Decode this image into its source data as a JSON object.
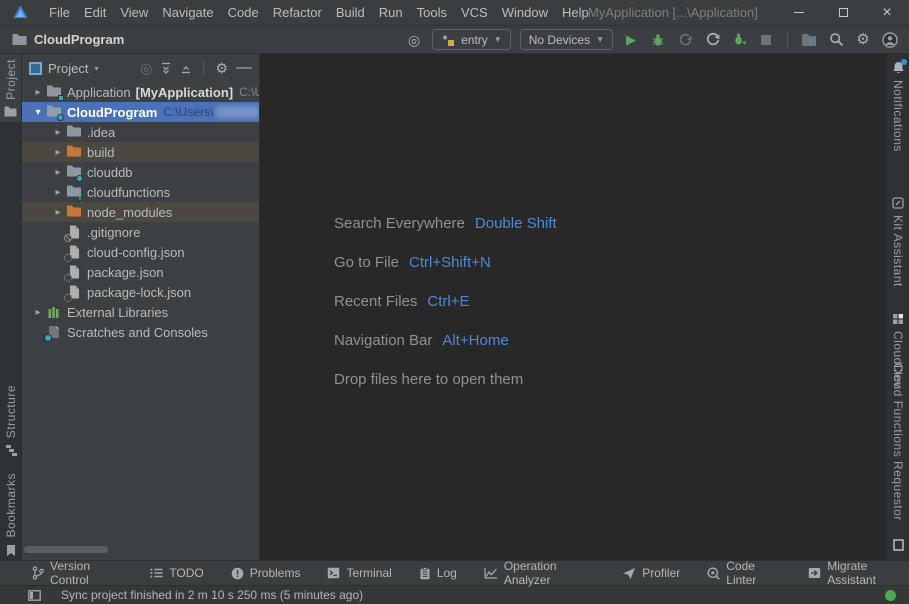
{
  "window": {
    "title": "MyApplication [...\\Application]"
  },
  "menu": {
    "items": [
      "File",
      "Edit",
      "View",
      "Navigate",
      "Code",
      "Refactor",
      "Build",
      "Run",
      "Tools",
      "VCS",
      "Window",
      "Help"
    ]
  },
  "toolbar": {
    "breadcrumb": "CloudProgram",
    "run_config": "entry",
    "device": "No Devices"
  },
  "project_panel": {
    "title": "Project",
    "tree": [
      {
        "name": "Application",
        "tag": "[MyApplication]",
        "path": "C:\\U"
      },
      {
        "name": "CloudProgram",
        "path": "C:\\Users\\"
      },
      {
        "name": ".idea"
      },
      {
        "name": "build"
      },
      {
        "name": "clouddb"
      },
      {
        "name": "cloudfunctions"
      },
      {
        "name": "node_modules"
      },
      {
        "name": ".gitignore"
      },
      {
        "name": "cloud-config.json"
      },
      {
        "name": "package.json"
      },
      {
        "name": "package-lock.json"
      },
      {
        "name": "External Libraries"
      },
      {
        "name": "Scratches and Consoles"
      }
    ]
  },
  "welcome": {
    "lines": [
      {
        "label": "Search Everywhere",
        "shortcut": "Double Shift"
      },
      {
        "label": "Go to File",
        "shortcut": "Ctrl+Shift+N"
      },
      {
        "label": "Recent Files",
        "shortcut": "Ctrl+E"
      },
      {
        "label": "Navigation Bar",
        "shortcut": "Alt+Home"
      },
      {
        "label": "Drop files here to open them",
        "shortcut": ""
      }
    ]
  },
  "stripes": {
    "left": [
      "Project",
      "Structure",
      "Bookmarks"
    ],
    "right": [
      "Notifications",
      "Kit Assistant",
      "CloudDev",
      "Cloud Functions Requestor"
    ]
  },
  "bottom_bar": {
    "items": [
      "Version Control",
      "TODO",
      "Problems",
      "Terminal",
      "Log",
      "Operation Analyzer",
      "Profiler",
      "Code Linter",
      "Migrate Assistant"
    ]
  },
  "statusbar": {
    "message": "Sync project finished in 2 m 10 s 250 ms (5 minutes ago)"
  },
  "glyphs": {
    "chevron_collapsed": "▸",
    "chevron_expanded": "▾",
    "caret_down": "▼",
    "panel_caret": "▾",
    "gear": "⚙",
    "target": "◎",
    "play": "▶",
    "minus": "—",
    "close": "×"
  },
  "colors": {
    "selection_blue": "#4A72B8",
    "shortcut_blue": "#4E8AD4",
    "run_green": "#5BA65B",
    "excluded_row_olive": "#4A4840",
    "status_green": "#4DAA4F",
    "notification_dot_blue": "#3592C4",
    "folder_orange": "#C4783C"
  }
}
